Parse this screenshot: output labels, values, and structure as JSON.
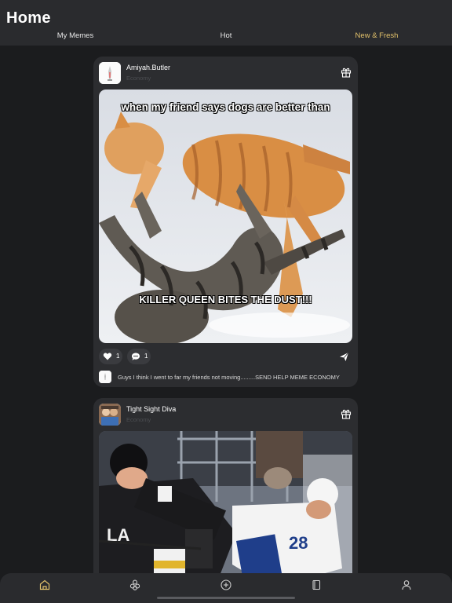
{
  "header": {
    "title": "Home",
    "tabs": [
      {
        "label": "My Memes",
        "active": false
      },
      {
        "label": "Hot",
        "active": false
      },
      {
        "label": "New & Fresh",
        "active": true
      }
    ]
  },
  "posts": [
    {
      "username": "Amiyah.Butler",
      "community": "Economy",
      "meme_top_text": "when my friend says dogs are better than",
      "meme_bottom_text": "KILLER QUEEN BITES THE DUST!!!",
      "likes": "1",
      "comments": "1",
      "caption": "Guys I think I went to far my friends not moving.........SEND HELP MEME ECONOMY"
    },
    {
      "username": "Tight Sight Diva",
      "community": "Economy"
    }
  ],
  "icons": {
    "gift": "gift-icon",
    "like": "heart-icon",
    "comment": "comment-icon",
    "share": "send-icon"
  },
  "bottom_nav": [
    "home-icon",
    "communities-icon",
    "create-icon",
    "saved-icon",
    "profile-icon"
  ],
  "colors": {
    "accent": "#e3c26b",
    "background": "#1b1c1e",
    "card": "#2c2d30"
  }
}
